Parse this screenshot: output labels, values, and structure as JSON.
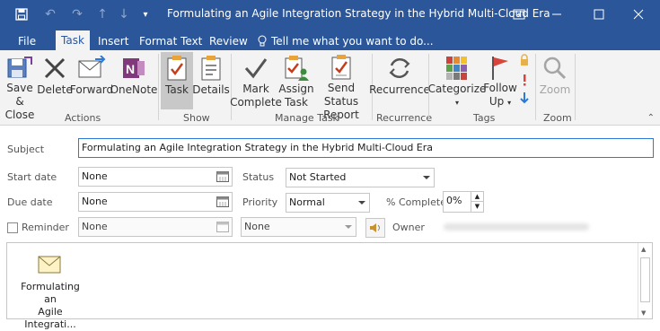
{
  "window": {
    "title": "Formulating an Agile Integration Strategy in the Hybrid Multi-Cloud Era",
    "icons": [
      "save-icon",
      "undo-icon",
      "redo-icon",
      "up-arrow-icon",
      "down-arrow-icon",
      "customize-icon",
      "restore-icon",
      "minimize-icon",
      "maximize-icon",
      "close-icon"
    ]
  },
  "tabs": [
    {
      "label": "File"
    },
    {
      "label": "Task"
    },
    {
      "label": "Insert"
    },
    {
      "label": "Format Text"
    },
    {
      "label": "Review"
    }
  ],
  "tell_me": "Tell me what you want to do...",
  "ribbon": {
    "actions": {
      "label": "Actions",
      "save_close_1": "Save &",
      "save_close_2": "Close",
      "delete": "Delete",
      "forward": "Forward",
      "onenote": "OneNote"
    },
    "show": {
      "label": "Show",
      "task": "Task",
      "details": "Details"
    },
    "manage": {
      "label": "Manage Task",
      "mark_1": "Mark",
      "mark_2": "Complete",
      "assign_1": "Assign",
      "assign_2": "Task",
      "send_1": "Send Status",
      "send_2": "Report"
    },
    "recurrence": {
      "label": "Recurrence",
      "button": "Recurrence"
    },
    "tags": {
      "label": "Tags",
      "categorize": "Categorize",
      "follow_1": "Follow",
      "follow_2": "Up"
    },
    "zoom": {
      "label": "Zoom",
      "button": "Zoom"
    }
  },
  "form": {
    "subject_label": "Subject",
    "subject_value": "Formulating an Agile Integration Strategy in the Hybrid Multi-Cloud Era",
    "start_label": "Start date",
    "start_value": "None",
    "due_label": "Due date",
    "due_value": "None",
    "reminder_label": "Reminder",
    "reminder_date": "None",
    "reminder_time": "None",
    "status_label": "Status",
    "status_value": "Not Started",
    "priority_label": "Priority",
    "priority_value": "Normal",
    "complete_label": "% Complete",
    "complete_value": "0%",
    "owner_label": "Owner"
  },
  "attachment": {
    "line1": "Formulating an",
    "line2": "Agile Integrati..."
  },
  "colors": {
    "brand": "#2b579a",
    "ribbon_bg": "#f3f3f3",
    "selected": "#c8c8c8"
  }
}
